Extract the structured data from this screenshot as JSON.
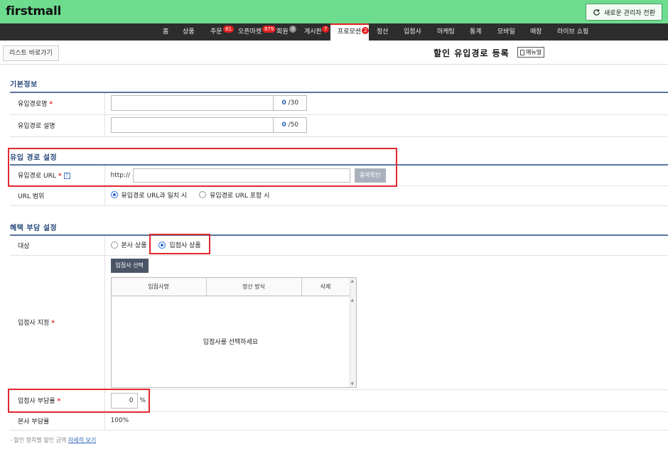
{
  "header": {
    "logo": "firstmall",
    "switch_label": "새로운 관리자 전환"
  },
  "nav": [
    {
      "label": "홈",
      "badge": ""
    },
    {
      "label": "상품",
      "badge": ""
    },
    {
      "label": "주문",
      "badge": "81"
    },
    {
      "label": "오픈마켓",
      "badge": "879"
    },
    {
      "label": "회원",
      "badge": "0"
    },
    {
      "label": "게시판",
      "badge": "7"
    },
    {
      "label": "프로모션",
      "badge": "2",
      "active": true
    },
    {
      "label": "정산",
      "badge": ""
    },
    {
      "label": "입점사",
      "badge": ""
    },
    {
      "label": "마케팅",
      "badge": ""
    },
    {
      "label": "통계",
      "badge": ""
    },
    {
      "label": "모바일",
      "badge": ""
    },
    {
      "label": "매장",
      "badge": ""
    },
    {
      "label": "라이브 쇼핑",
      "badge": ""
    }
  ],
  "page": {
    "back_label": "리스트 바로가기",
    "title": "할인 유입경로 등록",
    "manual_label": "매뉴얼"
  },
  "basic": {
    "title": "기본정보",
    "name_label": "유입경로명",
    "name_count": "0",
    "name_max": "/30",
    "desc_label": "유입경로 설명",
    "desc_count": "0",
    "desc_max": "/50"
  },
  "path": {
    "title": "유입 경로 설정",
    "url_label": "유입경로 URL",
    "url_prefix": "http://",
    "dup_label": "중복확인",
    "scope_label": "URL 범위",
    "scope_opt1": "유입경로 URL과 일치 시",
    "scope_opt2": "유입경로 URL 포함 시"
  },
  "benefit": {
    "title": "혜택 부담 설정",
    "target_label": "대상",
    "target_opt1": "본사 상품",
    "target_opt2": "입점사 상품",
    "seller_label": "입점사 지정",
    "select_btn": "입점사 선택",
    "col1": "입점사명",
    "col2": "정산 방식",
    "col3": "삭제",
    "empty": "입점사를 선택하세요",
    "seller_rate_label": "입점사 부담률",
    "seller_rate": "0",
    "unit": "%",
    "hq_rate_label": "본사 부담률",
    "hq_rate": "100%"
  },
  "footnote": {
    "text": "- 할인 항목별 할인 금액",
    "link": "자세히 보기"
  }
}
